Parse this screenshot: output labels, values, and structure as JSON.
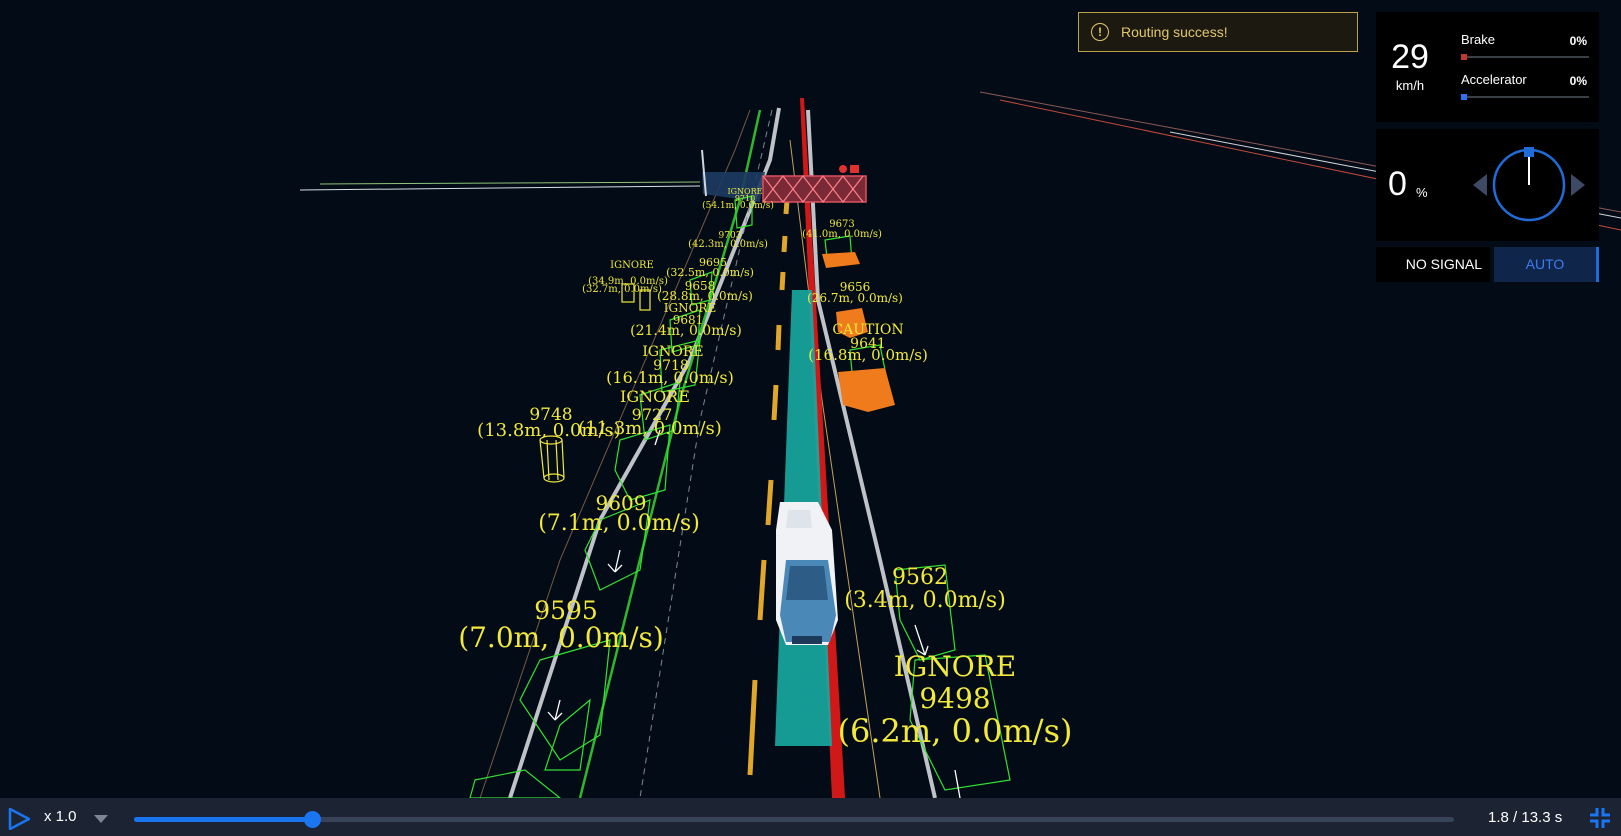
{
  "toast": {
    "icon": "warning-circle-icon",
    "message": "Routing success!"
  },
  "dashboard": {
    "speed": {
      "value": "29",
      "unit": "km/h"
    },
    "brake": {
      "label": "Brake",
      "percent": "0%",
      "level": 0,
      "color": "#c0392b"
    },
    "accelerator": {
      "label": "Accelerator",
      "percent": "0%",
      "level": 0,
      "color": "#2f6ff2"
    },
    "steering": {
      "value": "0",
      "unit": "%",
      "icons": [
        "steer-left-arrow-icon",
        "steering-wheel-icon",
        "steer-right-arrow-icon"
      ]
    },
    "traffic_signal": "NO SIGNAL",
    "driving_mode": "AUTO"
  },
  "obstacles": {
    "o9710": {
      "tag": "IGNORE",
      "id": "9710",
      "info": "(54.1m, 0.0m/s)"
    },
    "o9703": {
      "id": "9703",
      "info": "(42.3m, 0.0m/s)"
    },
    "o9673": {
      "id": "9673",
      "info": "(41.0m, 0.0m/s)"
    },
    "o9695": {
      "id": "9695",
      "info": "(32.5m, 0.0m/s)"
    },
    "o9658": {
      "id": "9658",
      "info": "(28.8m, 0.0m/s)"
    },
    "o9656": {
      "id": "9656",
      "info": "(26.7m, 0.0m/s)"
    },
    "o9681": {
      "tag": "IGNORE",
      "id": "9681",
      "info": "(21.4m, 0.0m/s)"
    },
    "o9641": {
      "tag": "CAUTION",
      "id": "9641",
      "info": "(16.8m, 0.0m/s)"
    },
    "o9718": {
      "tag": "IGNORE",
      "id": "9718",
      "info": "(16.1m, 0.0m/s)"
    },
    "o9727": {
      "tag": "IGNORE",
      "id": "9727",
      "info": "(11.3m, 0.0m/s)"
    },
    "o9748": {
      "id": "9748",
      "info": "(13.8m, 0.0m/s)"
    },
    "o9609": {
      "id": "9609",
      "info": "(7.1m, 0.0m/s)"
    },
    "o9562": {
      "id": "9562",
      "info": "(3.4m, 0.0m/s)"
    },
    "o9595": {
      "id": "9595",
      "info": "(7.0m, 0.0m/s)"
    },
    "o9498": {
      "tag": "IGNORE",
      "id": "9498",
      "info": "(6.2m, 0.0m/s)"
    },
    "cluster": {
      "tag": "IGNORE",
      "info1": "(34.9m, 0.0m/s)",
      "info2": "(32.7m, 0.0m/s)"
    }
  },
  "playback": {
    "play_icon": "play-icon",
    "rate": "x 1.0",
    "rate_dropdown_icon": "chevron-down-icon",
    "time": "1.8 / 13.3 s",
    "progress": 0.135,
    "fullscreen_icon": "exit-fullscreen-icon"
  }
}
